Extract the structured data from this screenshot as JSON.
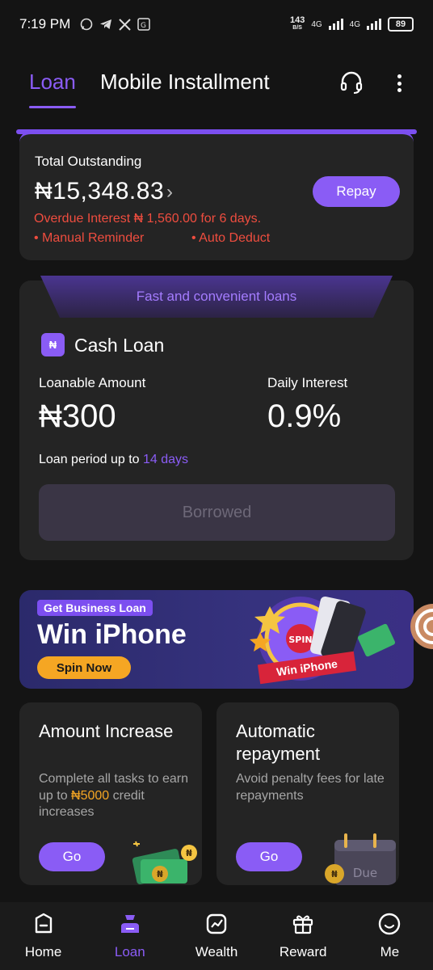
{
  "status_bar": {
    "time": "7:19 PM",
    "speed_value": "143",
    "speed_unit": "B/S",
    "network_1": "4G",
    "network_2": "4G",
    "battery": "89",
    "app_icons": [
      "whatsapp-icon",
      "telegram-icon",
      "x-icon",
      "translate-icon"
    ]
  },
  "header": {
    "tabs": [
      {
        "label": "Loan",
        "active": true
      },
      {
        "label": "Mobile Installment",
        "active": false
      }
    ]
  },
  "outstanding": {
    "label": "Total Outstanding",
    "amount": "₦15,348.83",
    "repay_label": "Repay",
    "overdue_text": "Overdue Interest ₦ 1,560.00 for 6 days.",
    "manual_reminder": "• Manual Reminder",
    "auto_deduct": "• Auto Deduct"
  },
  "cash_loan": {
    "banner": "Fast and convenient loans",
    "title": "Cash Loan",
    "loanable_label": "Loanable Amount",
    "loanable_value": "₦300",
    "interest_label": "Daily Interest",
    "interest_value": "0.9%",
    "period_prefix": "Loan period up to",
    "period_days": "14 days",
    "button_label": "Borrowed"
  },
  "promo": {
    "tag": "Get Business Loan",
    "title": "Win iPhone",
    "button": "Spin Now",
    "ribbon": "Win iPhone",
    "spin_label": "SPIN"
  },
  "features": [
    {
      "title": "Amount Increase",
      "desc_prefix": "Complete all tasks to earn up to",
      "desc_highlight": "₦5000",
      "desc_suffix": "credit increases",
      "button": "Go"
    },
    {
      "title": "Automatic repayment",
      "desc": "Avoid penalty fees for late repayments",
      "button": "Go",
      "art_label": "Due"
    }
  ],
  "bottom_nav": [
    {
      "label": "Home",
      "icon": "home-icon",
      "active": false
    },
    {
      "label": "Loan",
      "icon": "loan-icon",
      "active": true
    },
    {
      "label": "Wealth",
      "icon": "wealth-icon",
      "active": false
    },
    {
      "label": "Reward",
      "icon": "gift-icon",
      "active": false
    },
    {
      "label": "Me",
      "icon": "profile-icon",
      "active": false
    }
  ],
  "colors": {
    "accent": "#8a5cf5",
    "warning": "#ef4d3f",
    "highlight": "#f5a623",
    "background": "#141414",
    "card": "#242424"
  }
}
